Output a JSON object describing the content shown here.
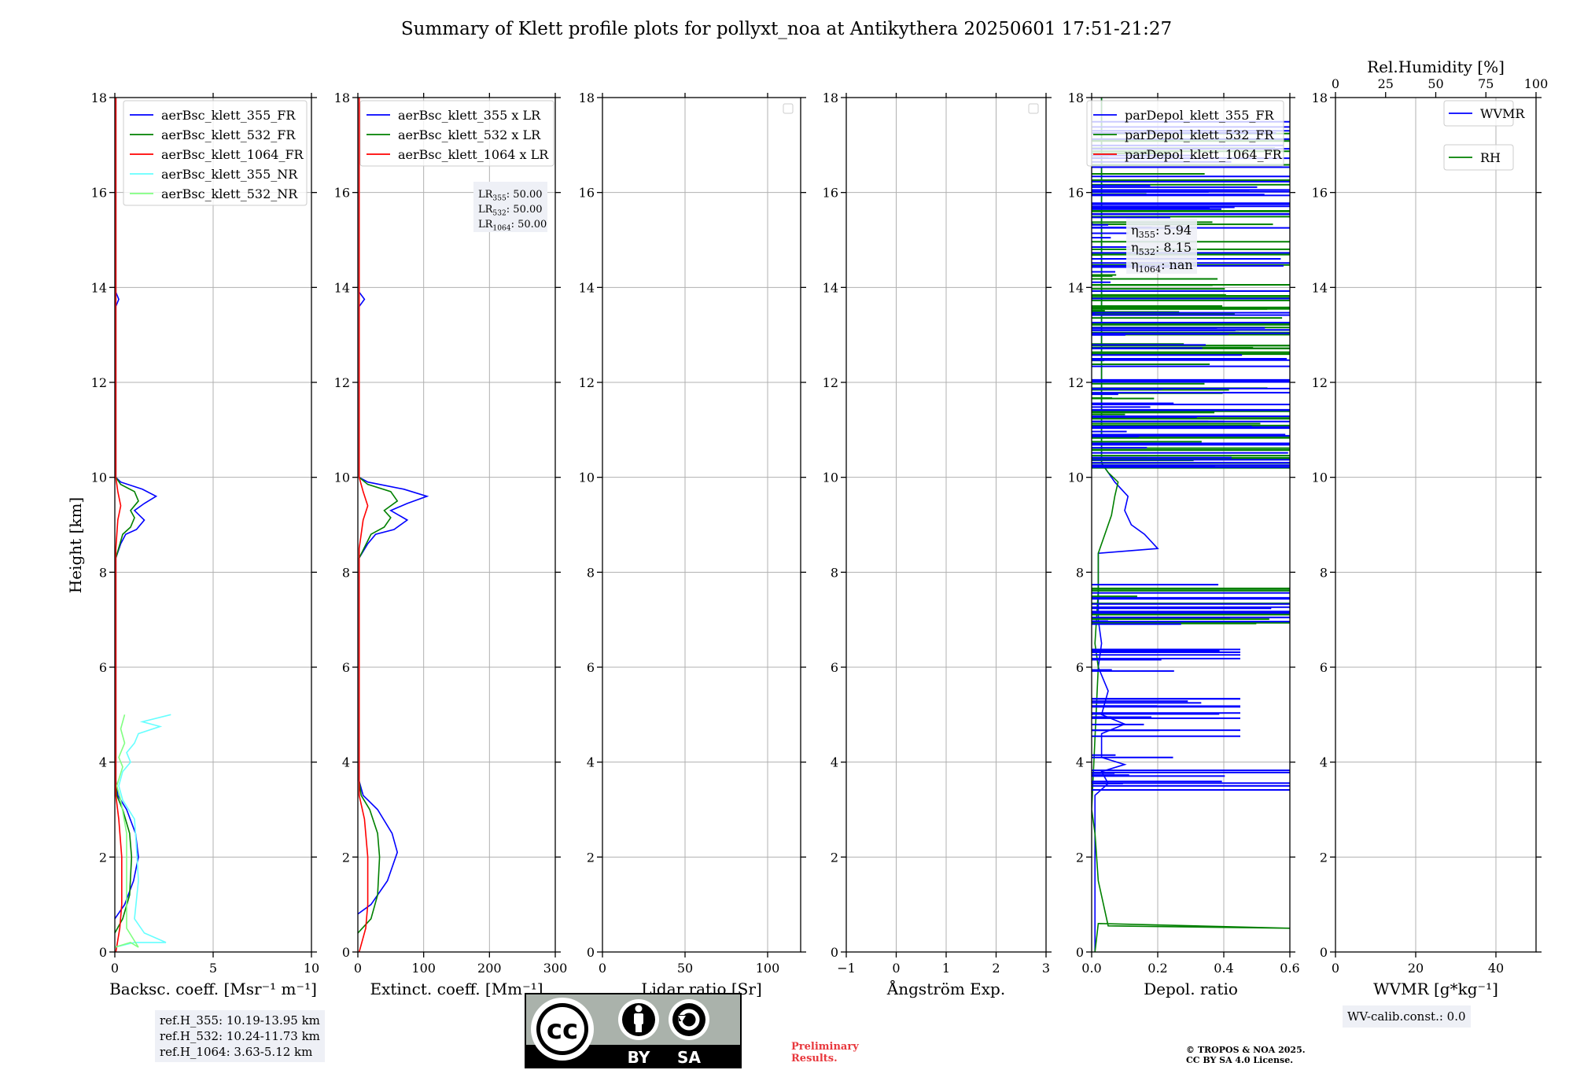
{
  "figure": {
    "title": "Summary of Klett profile plots for pollyxt_noa at Antikythera 20250601 17:51-21:27",
    "ylabel": "Height [km]",
    "y_ticks": [
      "0",
      "2",
      "4",
      "6",
      "8",
      "10",
      "12",
      "14",
      "16",
      "18"
    ],
    "colors": {
      "b355": "#0000ff",
      "b532": "#008000",
      "b1064": "#ff0000",
      "nr355": "#66ffff",
      "nr532": "#80ff80",
      "grid": "#b0b0b0",
      "infobox": "#eef0f6",
      "prelim": "#e8383d"
    }
  },
  "panels": {
    "backscatter": {
      "xlabel": "Backsc. coeff. [Msr⁻¹ m⁻¹]",
      "x_ticks": [
        "0",
        "5",
        "10"
      ],
      "legend": [
        "aerBsc_klett_355_FR",
        "aerBsc_klett_532_FR",
        "aerBsc_klett_1064_FR",
        "aerBsc_klett_355_NR",
        "aerBsc_klett_532_NR"
      ]
    },
    "extinction": {
      "xlabel": "Extinct. coeff. [Mm⁻¹]",
      "x_ticks": [
        "0",
        "100",
        "200",
        "300"
      ],
      "legend": [
        "aerBsc_klett_355 x LR",
        "aerBsc_klett_532 x LR",
        "aerBsc_klett_1064 x LR"
      ],
      "lr_box": [
        {
          "label": "LR",
          "sub": "355",
          "value": ": 50.00"
        },
        {
          "label": "LR",
          "sub": "532",
          "value": ": 50.00"
        },
        {
          "label": "LR",
          "sub": "1064",
          "value": ": 50.00"
        }
      ]
    },
    "lidar_ratio": {
      "xlabel": "Lidar ratio [Sr]",
      "x_ticks": [
        "0",
        "50",
        "100"
      ]
    },
    "angstrom": {
      "xlabel": "Ångström Exp.",
      "x_ticks": [
        "−1",
        "0",
        "1",
        "2",
        "3"
      ]
    },
    "depol": {
      "xlabel": "Depol. ratio",
      "x_ticks": [
        "0.0",
        "0.2",
        "0.4",
        "0.6"
      ],
      "legend": [
        "parDepol_klett_355_FR",
        "parDepol_klett_532_FR",
        "parDepol_klett_1064_FR"
      ],
      "eta_box": [
        {
          "label": "η",
          "sub": "355",
          "value": ": 5.94"
        },
        {
          "label": "η",
          "sub": "532",
          "value": ": 8.15"
        },
        {
          "label": "η",
          "sub": "1064",
          "value": ": nan"
        }
      ]
    },
    "wvmr": {
      "xlabel": "WVMR [g*kg⁻¹]",
      "x_ticks": [
        "0",
        "20",
        "40"
      ],
      "top_label": "Rel.Humidity [%]",
      "top_ticks": [
        "0",
        "25",
        "50",
        "75",
        "100"
      ],
      "legend": [
        "WVMR",
        "RH"
      ]
    }
  },
  "ref_heights": [
    "ref.H_355: 10.19-13.95 km",
    "ref.H_532: 10.24-11.73 km",
    "ref.H_1064: 3.63-5.12 km"
  ],
  "wv_calib": "WV-calib.const.: 0.0",
  "preliminary": [
    "Preliminary",
    "Results."
  ],
  "copyright": [
    "© TROPOS & NOA 2025.",
    "CC BY SA 4.0 License."
  ],
  "license_badge": {
    "by": "BY",
    "sa": "SA",
    "cc": "cc"
  },
  "chart_data": [
    {
      "type": "line",
      "title": "",
      "xlabel": "Backsc. coeff. [Msr⁻¹ m⁻¹]",
      "ylabel": "Height [km]",
      "xlim": [
        0,
        10
      ],
      "ylim": [
        0,
        18
      ],
      "grid": true,
      "legend": "top-right",
      "series": [
        {
          "name": "aerBsc_klett_355_FR",
          "points": [
            [
              0.0,
              0.7
            ],
            [
              0.5,
              1.0
            ],
            [
              0.95,
              1.5
            ],
            [
              1.2,
              2.0
            ],
            [
              1.05,
              2.5
            ],
            [
              0.6,
              3.0
            ],
            [
              0.15,
              3.3
            ],
            [
              0.05,
              3.6
            ],
            [
              0.05,
              6.0
            ],
            [
              0.05,
              8.3
            ],
            [
              0.3,
              8.6
            ],
            [
              0.55,
              8.8
            ],
            [
              1.1,
              8.9
            ],
            [
              1.5,
              9.1
            ],
            [
              1.0,
              9.3
            ],
            [
              1.5,
              9.45
            ],
            [
              2.1,
              9.6
            ],
            [
              1.4,
              9.75
            ],
            [
              0.3,
              9.9
            ],
            [
              0.05,
              10.0
            ],
            [
              0.05,
              13.6
            ],
            [
              0.2,
              13.75
            ],
            [
              0.05,
              13.9
            ],
            [
              0.05,
              18.0
            ]
          ]
        },
        {
          "name": "aerBsc_klett_532_FR",
          "points": [
            [
              0.0,
              0.4
            ],
            [
              0.4,
              0.7
            ],
            [
              0.75,
              1.2
            ],
            [
              0.85,
              2.0
            ],
            [
              0.75,
              2.5
            ],
            [
              0.4,
              3.0
            ],
            [
              0.1,
              3.3
            ],
            [
              0.05,
              3.6
            ],
            [
              0.05,
              8.3
            ],
            [
              0.4,
              8.8
            ],
            [
              0.8,
              8.95
            ],
            [
              1.0,
              9.15
            ],
            [
              0.8,
              9.3
            ],
            [
              1.2,
              9.5
            ],
            [
              1.0,
              9.7
            ],
            [
              0.3,
              9.85
            ],
            [
              0.05,
              10.0
            ],
            [
              0.05,
              18.0
            ]
          ]
        },
        {
          "name": "aerBsc_klett_1064_FR",
          "points": [
            [
              0.05,
              0.0
            ],
            [
              0.25,
              0.5
            ],
            [
              0.35,
              1.0
            ],
            [
              0.35,
              2.0
            ],
            [
              0.2,
              2.8
            ],
            [
              0.05,
              3.3
            ],
            [
              0.05,
              8.5
            ],
            [
              0.15,
              9.1
            ],
            [
              0.3,
              9.4
            ],
            [
              0.15,
              9.7
            ],
            [
              0.05,
              10.0
            ],
            [
              0.05,
              18.0
            ]
          ]
        },
        {
          "name": "aerBsc_klett_355_NR",
          "points": [
            [
              0.0,
              0.1
            ],
            [
              1.0,
              0.2
            ],
            [
              2.6,
              0.2
            ],
            [
              1.5,
              0.4
            ],
            [
              1.0,
              0.7
            ],
            [
              1.2,
              1.5
            ],
            [
              1.1,
              2.2
            ],
            [
              1.0,
              2.8
            ],
            [
              0.4,
              3.2
            ],
            [
              0.2,
              3.5
            ],
            [
              0.4,
              3.8
            ],
            [
              0.8,
              4.0
            ],
            [
              0.6,
              4.2
            ],
            [
              1.0,
              4.4
            ],
            [
              1.2,
              4.6
            ],
            [
              2.3,
              4.75
            ],
            [
              1.4,
              4.85
            ],
            [
              2.85,
              5.0
            ]
          ]
        },
        {
          "name": "aerBsc_klett_532_NR",
          "points": [
            [
              0.0,
              0.1
            ],
            [
              0.8,
              0.2
            ],
            [
              1.2,
              0.1
            ],
            [
              0.6,
              0.5
            ],
            [
              0.6,
              1.5
            ],
            [
              0.6,
              2.5
            ],
            [
              0.3,
              3.2
            ],
            [
              0.1,
              3.5
            ],
            [
              0.4,
              3.9
            ],
            [
              0.2,
              4.1
            ],
            [
              0.5,
              4.4
            ],
            [
              0.3,
              4.7
            ],
            [
              0.5,
              5.0
            ]
          ]
        }
      ]
    },
    {
      "type": "line",
      "title": "",
      "xlabel": "Extinct. coeff. [Mm⁻¹]",
      "ylabel": "Height [km]",
      "xlim": [
        0,
        300
      ],
      "ylim": [
        0,
        18
      ],
      "grid": true,
      "legend": "top-right",
      "series": [
        {
          "name": "aerBsc_klett_355 x LR",
          "points": [
            [
              0,
              0.8
            ],
            [
              20,
              1.0
            ],
            [
              45,
              1.5
            ],
            [
              60,
              2.1
            ],
            [
              52,
              2.5
            ],
            [
              30,
              3.0
            ],
            [
              8,
              3.3
            ],
            [
              2,
              3.6
            ],
            [
              2,
              6.0
            ],
            [
              2,
              8.3
            ],
            [
              15,
              8.6
            ],
            [
              27,
              8.8
            ],
            [
              55,
              8.9
            ],
            [
              75,
              9.1
            ],
            [
              50,
              9.3
            ],
            [
              75,
              9.45
            ],
            [
              105,
              9.6
            ],
            [
              70,
              9.75
            ],
            [
              15,
              9.9
            ],
            [
              2,
              10.0
            ],
            [
              2,
              13.6
            ],
            [
              10,
              13.75
            ],
            [
              2,
              13.9
            ],
            [
              2,
              18.0
            ]
          ]
        },
        {
          "name": "aerBsc_klett_532 x LR",
          "points": [
            [
              0,
              0.4
            ],
            [
              20,
              0.7
            ],
            [
              30,
              1.2
            ],
            [
              33,
              2.0
            ],
            [
              30,
              2.5
            ],
            [
              18,
              3.0
            ],
            [
              5,
              3.3
            ],
            [
              2,
              3.6
            ],
            [
              2,
              8.3
            ],
            [
              20,
              8.8
            ],
            [
              40,
              8.95
            ],
            [
              50,
              9.15
            ],
            [
              40,
              9.3
            ],
            [
              60,
              9.5
            ],
            [
              50,
              9.7
            ],
            [
              15,
              9.85
            ],
            [
              2,
              10.0
            ],
            [
              2,
              18.0
            ]
          ]
        },
        {
          "name": "aerBsc_klett_1064 x LR",
          "points": [
            [
              2,
              0.0
            ],
            [
              12,
              0.5
            ],
            [
              15,
              1.0
            ],
            [
              15,
              2.0
            ],
            [
              10,
              2.8
            ],
            [
              2,
              3.3
            ],
            [
              2,
              8.5
            ],
            [
              8,
              9.1
            ],
            [
              15,
              9.4
            ],
            [
              8,
              9.7
            ],
            [
              2,
              10.0
            ],
            [
              2,
              18.0
            ]
          ]
        }
      ]
    },
    {
      "type": "line",
      "title": "",
      "xlabel": "Lidar ratio [Sr]",
      "ylabel": "Height [km]",
      "xlim": [
        0,
        120
      ],
      "ylim": [
        0,
        18
      ],
      "grid": true,
      "series": []
    },
    {
      "type": "line",
      "title": "",
      "xlabel": "Ångström Exp.",
      "ylabel": "Height [km]",
      "xlim": [
        -1,
        3
      ],
      "ylim": [
        0,
        18
      ],
      "grid": true,
      "series": []
    },
    {
      "type": "line",
      "title": "",
      "xlabel": "Depol. ratio",
      "ylabel": "Height [km]",
      "xlim": [
        0,
        0.6
      ],
      "ylim": [
        0,
        18
      ],
      "grid": true,
      "legend": "top-right",
      "series": [
        {
          "name": "parDepol_klett_355_FR",
          "points": [
            [
              0.01,
              0.0
            ],
            [
              0.01,
              3.3
            ],
            [
              0.05,
              3.55
            ],
            [
              0.03,
              3.8
            ],
            [
              0.1,
              3.95
            ],
            [
              0.03,
              4.1
            ],
            [
              0.03,
              4.6
            ],
            [
              0.1,
              4.8
            ],
            [
              0.03,
              5.0
            ],
            [
              0.05,
              5.5
            ],
            [
              0.02,
              6.0
            ],
            [
              0.03,
              6.5
            ],
            [
              0.02,
              7.0
            ],
            [
              0.02,
              8.4
            ],
            [
              0.2,
              8.5
            ],
            [
              0.16,
              8.8
            ],
            [
              0.12,
              9.0
            ],
            [
              0.1,
              9.3
            ],
            [
              0.11,
              9.6
            ],
            [
              0.07,
              9.9
            ],
            [
              0.05,
              10.1
            ],
            [
              0.03,
              10.3
            ],
            [
              0.03,
              18.0
            ]
          ]
        },
        {
          "name": "parDepol_klett_532_FR",
          "points": [
            [
              0.01,
              0.0
            ],
            [
              0.02,
              0.6
            ],
            [
              0.6,
              0.5
            ],
            [
              0.05,
              0.55
            ],
            [
              0.02,
              1.5
            ],
            [
              0.01,
              2.5
            ],
            [
              0.0,
              3.0
            ],
            [
              0.02,
              6.0
            ],
            [
              0.01,
              6.5
            ],
            [
              0.02,
              7.6
            ],
            [
              0.02,
              8.4
            ],
            [
              0.04,
              8.8
            ],
            [
              0.06,
              9.2
            ],
            [
              0.07,
              9.6
            ],
            [
              0.08,
              9.9
            ],
            [
              0.05,
              10.1
            ],
            [
              0.03,
              10.3
            ],
            [
              0.03,
              18.0
            ]
          ]
        },
        {
          "name": "parDepol_klett_1064_FR",
          "points": []
        }
      ]
    },
    {
      "type": "line",
      "title": "",
      "xlabel": "WVMR [g*kg⁻¹]",
      "ylabel": "Height [km]",
      "xlim": [
        0,
        50
      ],
      "ylim": [
        0,
        18
      ],
      "grid": true,
      "legend": "top-right",
      "secondary_x": {
        "label": "Rel.Humidity [%]",
        "lim": [
          0,
          100
        ]
      },
      "series": [
        {
          "name": "WVMR",
          "points": []
        },
        {
          "name": "RH",
          "points": []
        }
      ]
    }
  ]
}
